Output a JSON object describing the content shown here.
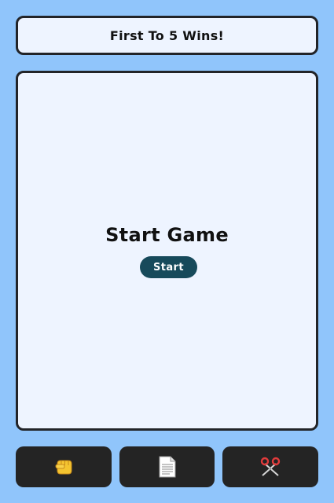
{
  "banner": {
    "text": "First To 5 Wins!"
  },
  "game": {
    "title": "Start Game",
    "start_label": "Start"
  },
  "choices": [
    {
      "name": "rock",
      "icon": "fist-icon"
    },
    {
      "name": "paper",
      "icon": "paper-icon"
    },
    {
      "name": "scissors",
      "icon": "scissors-icon"
    }
  ],
  "colors": {
    "background": "#90c5fb",
    "panel": "#eef4ff",
    "border": "#222428",
    "start_button": "#174a5b",
    "choice_button": "#242424"
  }
}
